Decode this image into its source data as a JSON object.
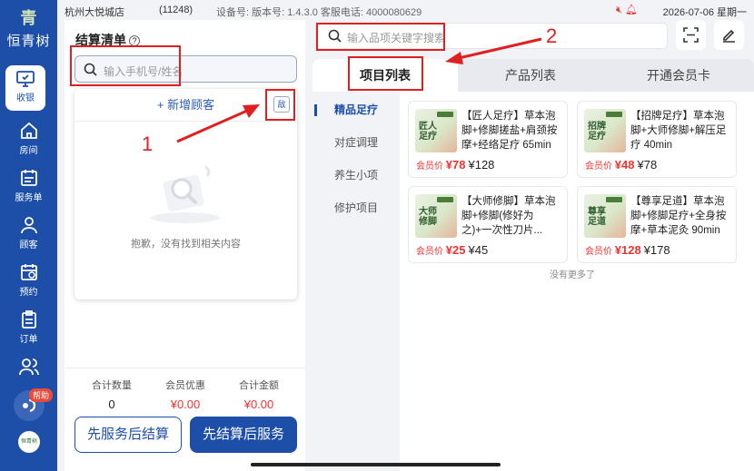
{
  "status_bar": {
    "store_name": "杭州大悦城店",
    "store_code": "(11248)",
    "device_meta": "设备号: 版本号: 1.4.3.0 客服电话: 4000080629",
    "datetime": "2026-07-06 星期一"
  },
  "nav": {
    "logo_mark": "青",
    "brand": "恒青树",
    "items": [
      {
        "label": "收银",
        "icon": "monitor-icon"
      },
      {
        "label": "房间",
        "icon": "home-icon"
      },
      {
        "label": "服务单",
        "icon": "service-order-icon"
      },
      {
        "label": "顾客",
        "icon": "user-icon"
      },
      {
        "label": "预约",
        "icon": "calendar-icon"
      },
      {
        "label": "订单",
        "icon": "clipboard-icon"
      },
      {
        "label": "",
        "icon": "users-icon"
      }
    ],
    "help_badge": "帮助",
    "avatar_text": "恒青树"
  },
  "settle": {
    "title": "结算清单",
    "phone_placeholder": "输入手机号/姓名",
    "add_customer": "+ 新增顾客",
    "scan_label": "敌",
    "empty_text": "抱歉，没有找到相关内容",
    "totals": [
      {
        "label": "合计数量",
        "value": "0"
      },
      {
        "label": "会员优惠",
        "value": "¥0.00"
      },
      {
        "label": "合计金额",
        "value": "¥0.00"
      }
    ],
    "btn_service_first": "先服务后结算",
    "btn_settle_first": "先结算后服务"
  },
  "products": {
    "search_placeholder": "输入品项关键字搜索",
    "tabs": [
      "项目列表",
      "产品列表",
      "开通会员卡"
    ],
    "categories": [
      "精品足疗",
      "对症调理",
      "养生小项",
      "修护项目"
    ],
    "member_label": "会员价",
    "items": [
      {
        "title": "【匠人足疗】草本泡脚+修脚搓盐+肩颈按摩+经络足疗 65min",
        "thumb_text": "匠人足疗",
        "member_price": "¥78",
        "price": "¥128"
      },
      {
        "title": "【招牌足疗】草本泡脚+大师修脚+解压足疗 40min",
        "thumb_text": "招牌足疗",
        "member_price": "¥48",
        "price": "¥78"
      },
      {
        "title": "【大师修脚】草本泡脚+修脚(修好为之)+一次性刀片...",
        "thumb_text": "大师修脚",
        "member_price": "¥25",
        "price": "¥45"
      },
      {
        "title": "【尊享足道】草本泡脚+修脚足疗+全身按摩+草本泥灸 90min",
        "thumb_text": "尊享足道",
        "member_price": "¥128",
        "price": "¥178"
      }
    ],
    "no_more": "没有更多了"
  },
  "annotations": {
    "label_1": "1",
    "label_2": "2"
  },
  "colors": {
    "primary": "#1d4fa8",
    "price_red": "#e33333",
    "annotation_red": "#e02020"
  }
}
